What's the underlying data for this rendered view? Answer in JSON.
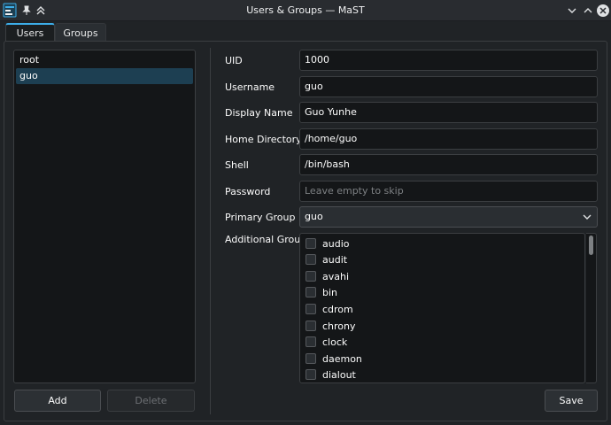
{
  "window": {
    "title": "Users & Groups — MaST"
  },
  "tabs": [
    {
      "label": "Users",
      "active": true
    },
    {
      "label": "Groups",
      "active": false
    }
  ],
  "users": {
    "items": [
      {
        "label": "root",
        "selected": false
      },
      {
        "label": "guo",
        "selected": true
      }
    ],
    "add_label": "Add",
    "delete_label": "Delete"
  },
  "form": {
    "uid_label": "UID",
    "uid_value": "1000",
    "username_label": "Username",
    "username_value": "guo",
    "display_name_label": "Display Name",
    "display_name_value": "Guo Yunhe",
    "home_label": "Home Directory",
    "home_value": "/home/guo",
    "shell_label": "Shell",
    "shell_value": "/bin/bash",
    "password_label": "Password",
    "password_placeholder": "Leave empty to skip",
    "primary_group_label": "Primary Group",
    "primary_group_value": "guo",
    "additional_groups_label": "Additional Groups",
    "additional_groups": [
      {
        "name": "audio",
        "checked": false
      },
      {
        "name": "audit",
        "checked": false
      },
      {
        "name": "avahi",
        "checked": false
      },
      {
        "name": "bin",
        "checked": false
      },
      {
        "name": "cdrom",
        "checked": false
      },
      {
        "name": "chrony",
        "checked": false
      },
      {
        "name": "clock",
        "checked": false
      },
      {
        "name": "daemon",
        "checked": false
      },
      {
        "name": "dialout",
        "checked": false
      }
    ],
    "save_label": "Save"
  },
  "colors": {
    "accent": "#3daee9",
    "selection": "#1d3f52",
    "background": "#202326",
    "field": "#141618"
  }
}
